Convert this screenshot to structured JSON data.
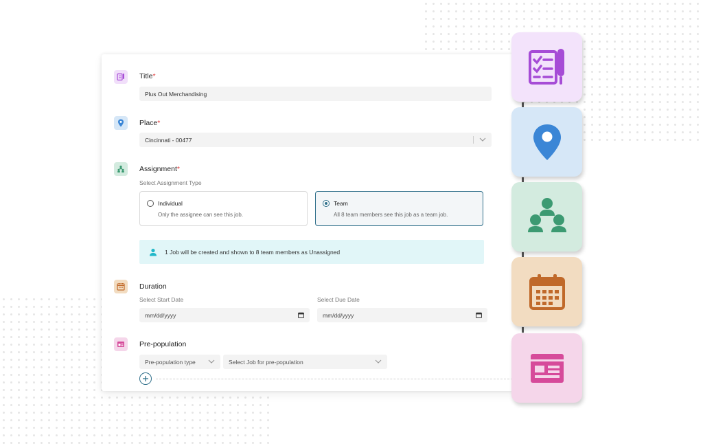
{
  "form": {
    "title": {
      "label": "Title",
      "required_mark": "*",
      "value": "Plus Out Merchandising"
    },
    "place": {
      "label": "Place",
      "required_mark": "*",
      "value": "Cincinnati - 00477"
    },
    "assignment": {
      "label": "Assignment",
      "required_mark": "*",
      "subtitle": "Select Assignment Type",
      "options": [
        {
          "label": "Individual",
          "description": "Only the assignee can see this job.",
          "selected": false
        },
        {
          "label": "Team",
          "description": "All 8 team members see this job as a team job.",
          "selected": true
        }
      ],
      "info": "1 Job will be created and shown to 8 team members as Unassigned"
    },
    "duration": {
      "label": "Duration",
      "start_label": "Select Start Date",
      "due_label": "Select Due Date",
      "start_placeholder": "mm/dd/yyyy",
      "due_placeholder": "mm/dd/yyyy"
    },
    "prepopulation": {
      "label": "Pre-population",
      "type_placeholder": "Pre-population type",
      "job_placeholder": "Select Job for pre-population"
    }
  },
  "icons": {
    "title": "checklist-icon",
    "place": "location-pin-icon",
    "assignment": "team-icon",
    "duration": "calendar-icon",
    "prepopulation": "layout-icon"
  },
  "colors": {
    "accent": "#2f6f8a",
    "required": "#e03b3b",
    "tile_checklist": "#f3e3fb",
    "tile_location": "#d6e7f7",
    "tile_team": "#d3ebdf",
    "tile_calendar": "#f2dcc1",
    "tile_layout": "#f5d6ea",
    "info_bg": "#e1f6f8"
  }
}
